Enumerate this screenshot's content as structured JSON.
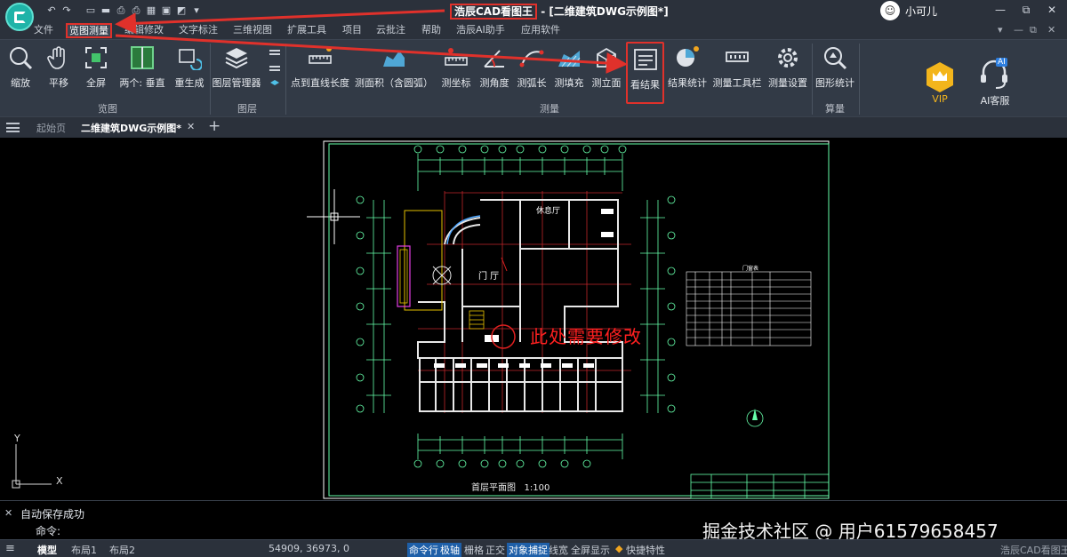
{
  "titlebar": {
    "app_name": "浩辰CAD看图王",
    "document": " - [二维建筑DWG示例图*]",
    "username": "小可儿",
    "avatar_glyph": "☺",
    "quick_access": [
      "↶",
      "↷",
      "▭",
      "▬",
      "⎙",
      "⎙",
      "▦",
      "▣",
      "◩",
      "▾"
    ],
    "window_controls": [
      "—",
      "⧉",
      "✕"
    ]
  },
  "menu": {
    "items": [
      "文件",
      "览图测量",
      "编辑修改",
      "文字标注",
      "三维视图",
      "扩展工具",
      "项目",
      "云批注",
      "帮助",
      "浩辰AI助手",
      "应用软件"
    ],
    "right": [
      "▾",
      "—",
      "⧉",
      "✕"
    ]
  },
  "ribbon": {
    "groups": {
      "browse": {
        "title": "览图",
        "buttons": [
          "缩放",
          "平移",
          "全屏",
          "两个: 垂直",
          "重生成"
        ]
      },
      "layer": {
        "title": "图层",
        "buttons": [
          "图层管理器"
        ]
      },
      "measure": {
        "title": "测量",
        "buttons": [
          "点到直线长度",
          "测面积（含圆弧）",
          "测坐标",
          "测角度",
          "测弧长",
          "测填充",
          "测立面",
          "看结果",
          "结果统计",
          "测量工具栏",
          "测量设置"
        ]
      },
      "calc": {
        "title": "算量",
        "buttons": [
          "图形统计"
        ]
      }
    },
    "vip": "VIP",
    "ai_service": "AI客服",
    "ai_badge": "AI",
    "accent_color": "#e0312b"
  },
  "tabs": {
    "home": "起始页",
    "active": "二维建筑DWG示例图*",
    "close": "✕",
    "add": "+"
  },
  "drawing": {
    "room_lounge": "休息厅",
    "room_hall": "门 厅",
    "annotation": "此处需要修改",
    "plan_title": "首层平面图",
    "scale": "1:100",
    "door_window_table": "门窗表",
    "ucs_y": "Y",
    "ucs_x": "X"
  },
  "command": {
    "history": "自动保存成功",
    "prompt": "命令:"
  },
  "status": {
    "model": "模型",
    "layout1": "布局1",
    "layout2": "布局2",
    "coords": "54909, 36973, 0",
    "toggles": [
      "命令行",
      "极轴",
      "栅格",
      "正交",
      "对象捕捉",
      "线宽",
      "全屏显示"
    ],
    "quick": "快捷特性",
    "brand": "浩辰CAD看图王"
  },
  "watermark": "掘金技术社区 @ 用户6157965845​7"
}
